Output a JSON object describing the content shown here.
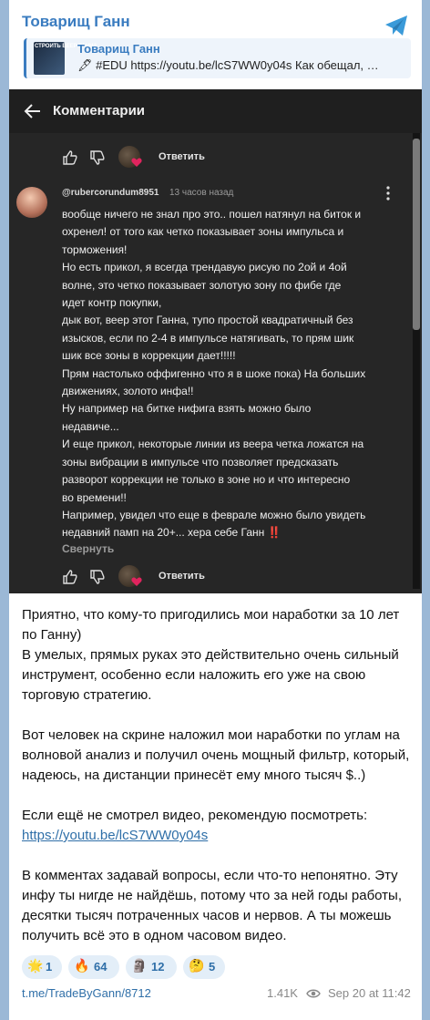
{
  "channel": {
    "name": "Товарищ Ганн",
    "logo": "telegram-icon"
  },
  "reply": {
    "thumb_text": "СТРОИТЬ ВЕЕР ГАННА",
    "name": "Товарищ Ганн",
    "text": "🖋 #EDU https://youtu.be/lcS7WW0y04s Как обещал, …"
  },
  "screenshot": {
    "title": "Комментарии",
    "reply_label": "Ответить",
    "comment": {
      "author": "@rubercorundum8951",
      "time": "13 часов назад",
      "lines": [
        "вообще ничего не знал про это.. пошел натянул на биток и",
        "охренел! от того как четко показывает зоны импульса и",
        "торможения!",
        "Но есть прикол, я всегда трендавую рисую по 2ой и 4ой",
        "волне, это четко показывает золотую зону по фибе где",
        "идет контр покупки,",
        "дык вот, веер этот Ганна, тупо простой квадратичный без",
        "изысков, если по 2-4 в импульсе натягивать, то прям шик",
        "шик все зоны в коррекции дает!!!!!",
        "Прям настолько оффигенно что я в шоке пока) На больших",
        "движениях, золото инфа!!",
        "Ну например на битке нифига взять можно было",
        "недавиче...",
        "И еще прикол, некоторые линии из веера четка ложатся на",
        "зоны вибрации в импульсе что позволяет предсказать",
        "разворот коррекции не только в зоне но и что интересно",
        "во времени!!",
        "Например, увидел что еще в феврале можно было увидеть",
        "недавний памп на 20+... хера себе Ганн ‼️"
      ],
      "collapse_label": "Свернуть"
    }
  },
  "message": {
    "p1": "Приятно, что кому-то пригодились мои наработки за 10 лет по Ганну)\nВ умелых, прямых руках это действительно очень сильный инструмент, особенно если наложить его уже на свою торговую стратегию.",
    "p2": "Вот человек на скрине наложил мои наработки по углам на волновой анализ и получил очень мощный фильтр, который, надеюсь, на дистанции принесёт ему много тысяч $..)",
    "p3_text": "Если ещё не смотрел видео, рекомендую посмотреть:",
    "p3_link": "https://youtu.be/lcS7WW0y04s",
    "p4": "В комментах задавай вопросы, если что-то непонятно. Эту инфу ты нигде не найдёшь, потому что за ней годы работы, десятки тысяч потраченных часов и нервов. А ты можешь получить всё это в одном часовом видео."
  },
  "reactions": [
    {
      "emoji": "🌟",
      "icon": "star-struck-icon",
      "count": "1"
    },
    {
      "emoji": "🔥",
      "icon": "fire-icon",
      "count": "64"
    },
    {
      "emoji": "🗿",
      "icon": "moai-icon",
      "count": "12"
    },
    {
      "emoji": "🤔",
      "icon": "thinking-face-icon",
      "count": "5"
    }
  ],
  "footer": {
    "link": "t.me/TradeByGann/8712",
    "views": "1.41K",
    "time": "Sep 20 at 11:42"
  },
  "colors": {
    "accent": "#3a7cc0",
    "link": "#2f6fa8",
    "dark_bg": "#262626",
    "chat_bg": "#9bb8d6"
  }
}
